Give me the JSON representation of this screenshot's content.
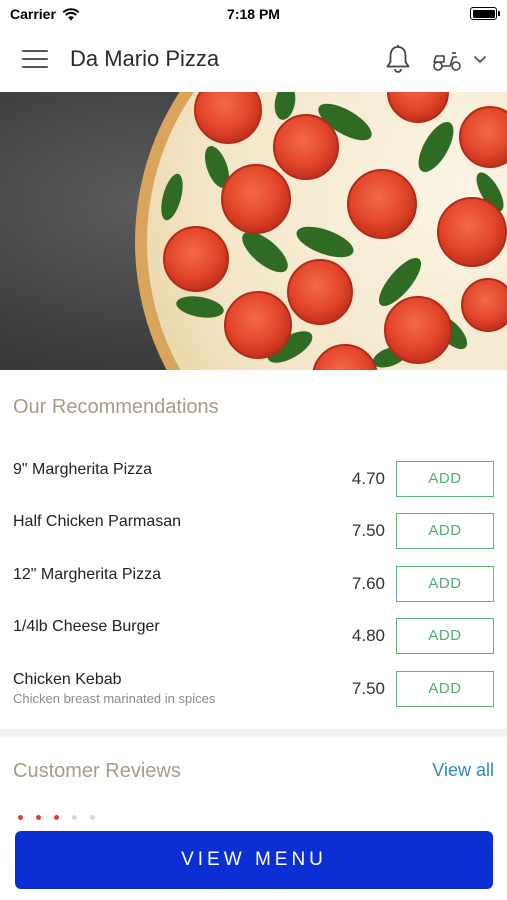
{
  "status_bar": {
    "carrier": "Carrier",
    "time": "7:18 PM"
  },
  "header": {
    "title": "Da Mario Pizza",
    "icons": [
      "menu-icon",
      "bell-icon",
      "scooter-icon",
      "chevron-down-icon"
    ]
  },
  "hero": {
    "image": "margherita-pizza-photo"
  },
  "recommendations": {
    "title": "Our Recommendations",
    "add_label": "ADD",
    "items": [
      {
        "name": "9\" Margherita Pizza",
        "price": "4.70",
        "description": ""
      },
      {
        "name": "Half Chicken Parmasan",
        "price": "7.50",
        "description": ""
      },
      {
        "name": "12\" Margherita Pizza",
        "price": "7.60",
        "description": ""
      },
      {
        "name": "1/4lb Cheese Burger",
        "price": "4.80",
        "description": ""
      },
      {
        "name": "Chicken Kebab",
        "price": "7.50",
        "description": "Chicken breast marinated in spices"
      }
    ]
  },
  "reviews": {
    "title": "Customer Reviews",
    "view_all": "View all"
  },
  "footer": {
    "view_menu_label": "VIEW MENU"
  },
  "colors": {
    "accent_button": "#0b2fd2",
    "add_border": "#5fb37f",
    "section_title": "#a79c86",
    "link": "#2a8cb8"
  }
}
